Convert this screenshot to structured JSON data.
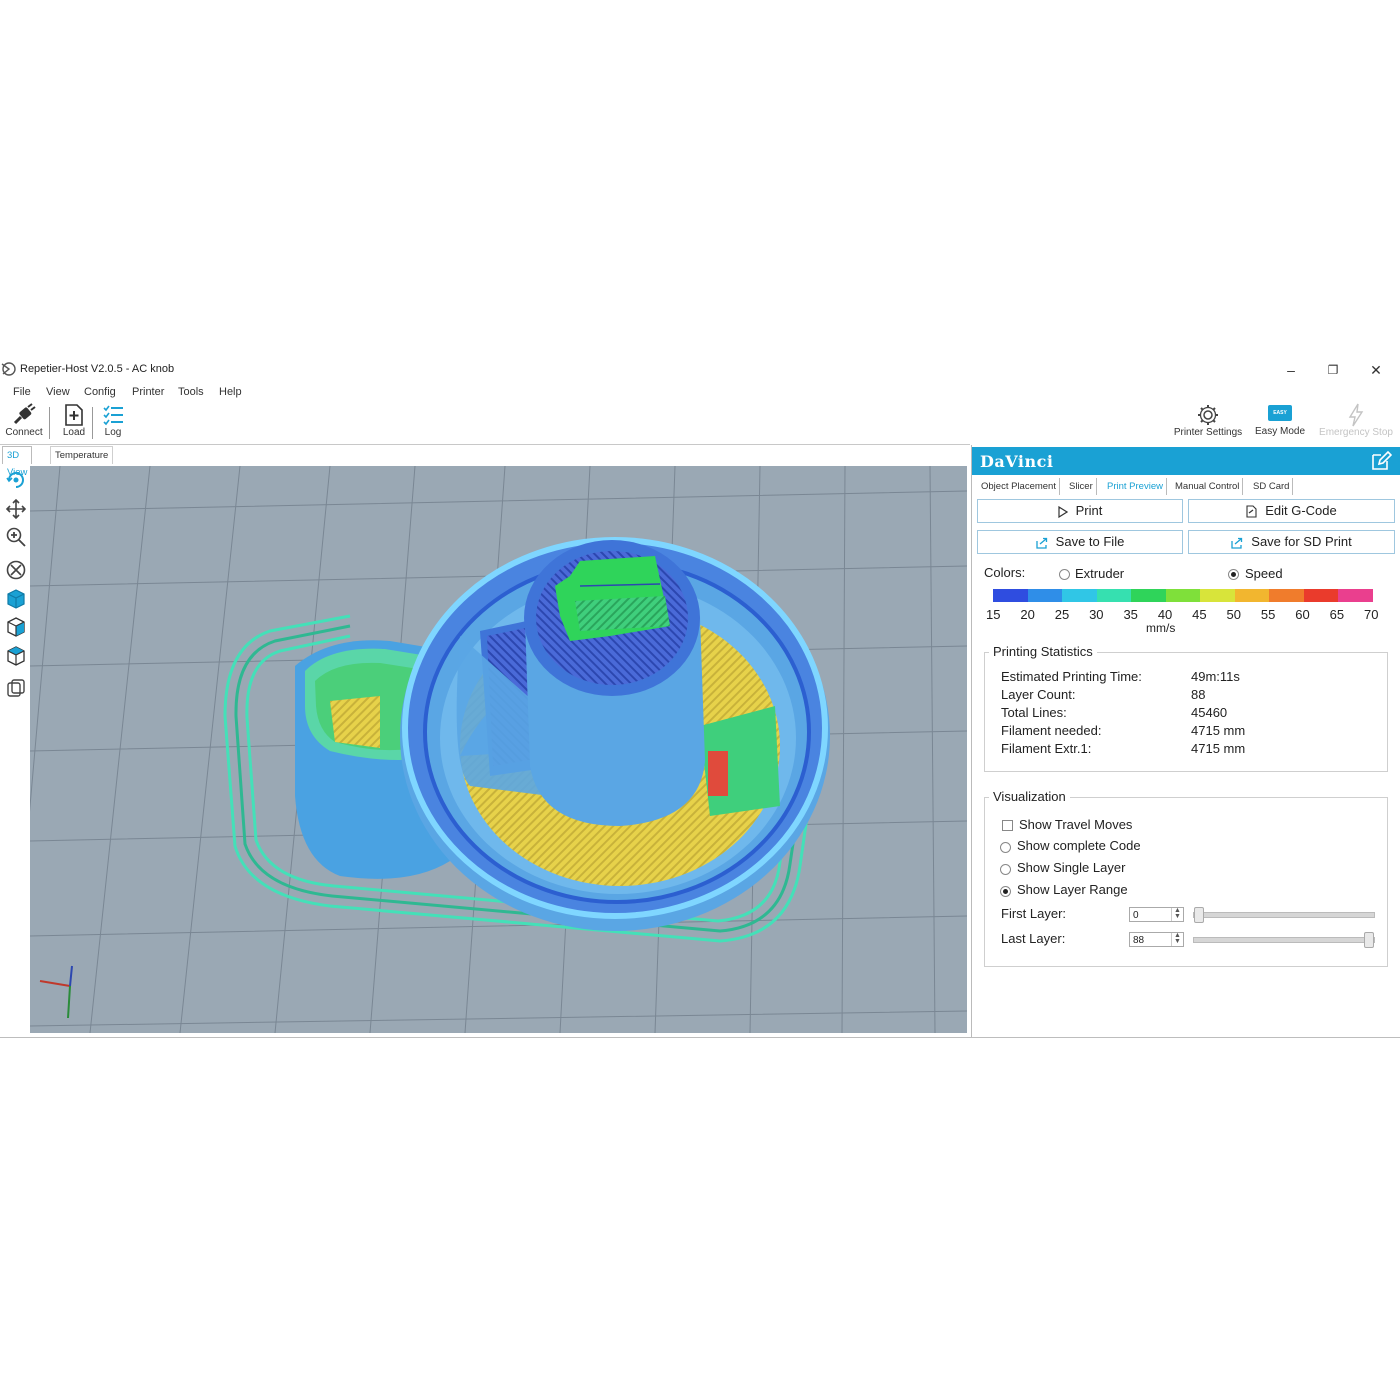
{
  "window": {
    "title": "Repetier-Host V2.0.5 - AC knob",
    "minimize": "–",
    "maximize": "❐",
    "close": "✕"
  },
  "menu": [
    "File",
    "View",
    "Config",
    "Printer",
    "Tools",
    "Help"
  ],
  "toolbar": {
    "connect": "Connect",
    "load": "Load",
    "log": "Log",
    "printer_settings": "Printer Settings",
    "easy_mode": "Easy Mode",
    "easy_badge": "EASY",
    "emergency_stop": "Emergency Stop"
  },
  "view_tabs": [
    "3D View",
    "Temperature Curve"
  ],
  "viewport_tools": [
    "rotate-icon",
    "move-icon",
    "zoom-icon",
    "fit-icon",
    "front-view-icon",
    "iso-view-icon",
    "top-view-icon",
    "toggle-perspective-icon"
  ],
  "panel": {
    "printer_name": "DaVinci",
    "tabs": [
      "Object Placement",
      "Slicer",
      "Print Preview",
      "Manual Control",
      "SD Card"
    ],
    "active_tab": "Print Preview",
    "buttons": {
      "print": "Print",
      "edit_gcode": "Edit G-Code",
      "save_to_file": "Save to File",
      "save_for_sd": "Save for SD Print"
    },
    "colors": {
      "label": "Colors:",
      "option_extruder": "Extruder",
      "option_speed": "Speed",
      "selected": "Speed",
      "scale_colors": [
        "#2f4de0",
        "#2f8ee8",
        "#30c6e6",
        "#36e0b0",
        "#2fd45a",
        "#7fe03a",
        "#d8e43a",
        "#f2b62f",
        "#f07c2c",
        "#ea3b2c",
        "#ea3f8e"
      ],
      "scale_ticks": [
        "15",
        "20",
        "25",
        "30",
        "35",
        "40",
        "45",
        "50",
        "55",
        "60",
        "65",
        "70"
      ],
      "unit": "mm/s"
    },
    "statistics": {
      "title": "Printing Statistics",
      "rows": [
        {
          "label": "Estimated Printing Time:",
          "value": "49m:11s"
        },
        {
          "label": "Layer Count:",
          "value": "88"
        },
        {
          "label": "Total Lines:",
          "value": "45460"
        },
        {
          "label": "Filament needed:",
          "value": "4715 mm"
        },
        {
          "label": "Filament Extr.1:",
          "value": "4715 mm"
        }
      ]
    },
    "visualization": {
      "title": "Visualization",
      "show_travel_moves": "Show Travel Moves",
      "show_complete_code": "Show complete Code",
      "show_single_layer": "Show Single Layer",
      "show_layer_range": "Show Layer Range",
      "selected": "Show Layer Range",
      "first_layer_label": "First Layer:",
      "first_layer_value": "0",
      "last_layer_label": "Last Layer:",
      "last_layer_value": "88",
      "first_layer_fraction": 0,
      "last_layer_fraction": 1
    }
  }
}
